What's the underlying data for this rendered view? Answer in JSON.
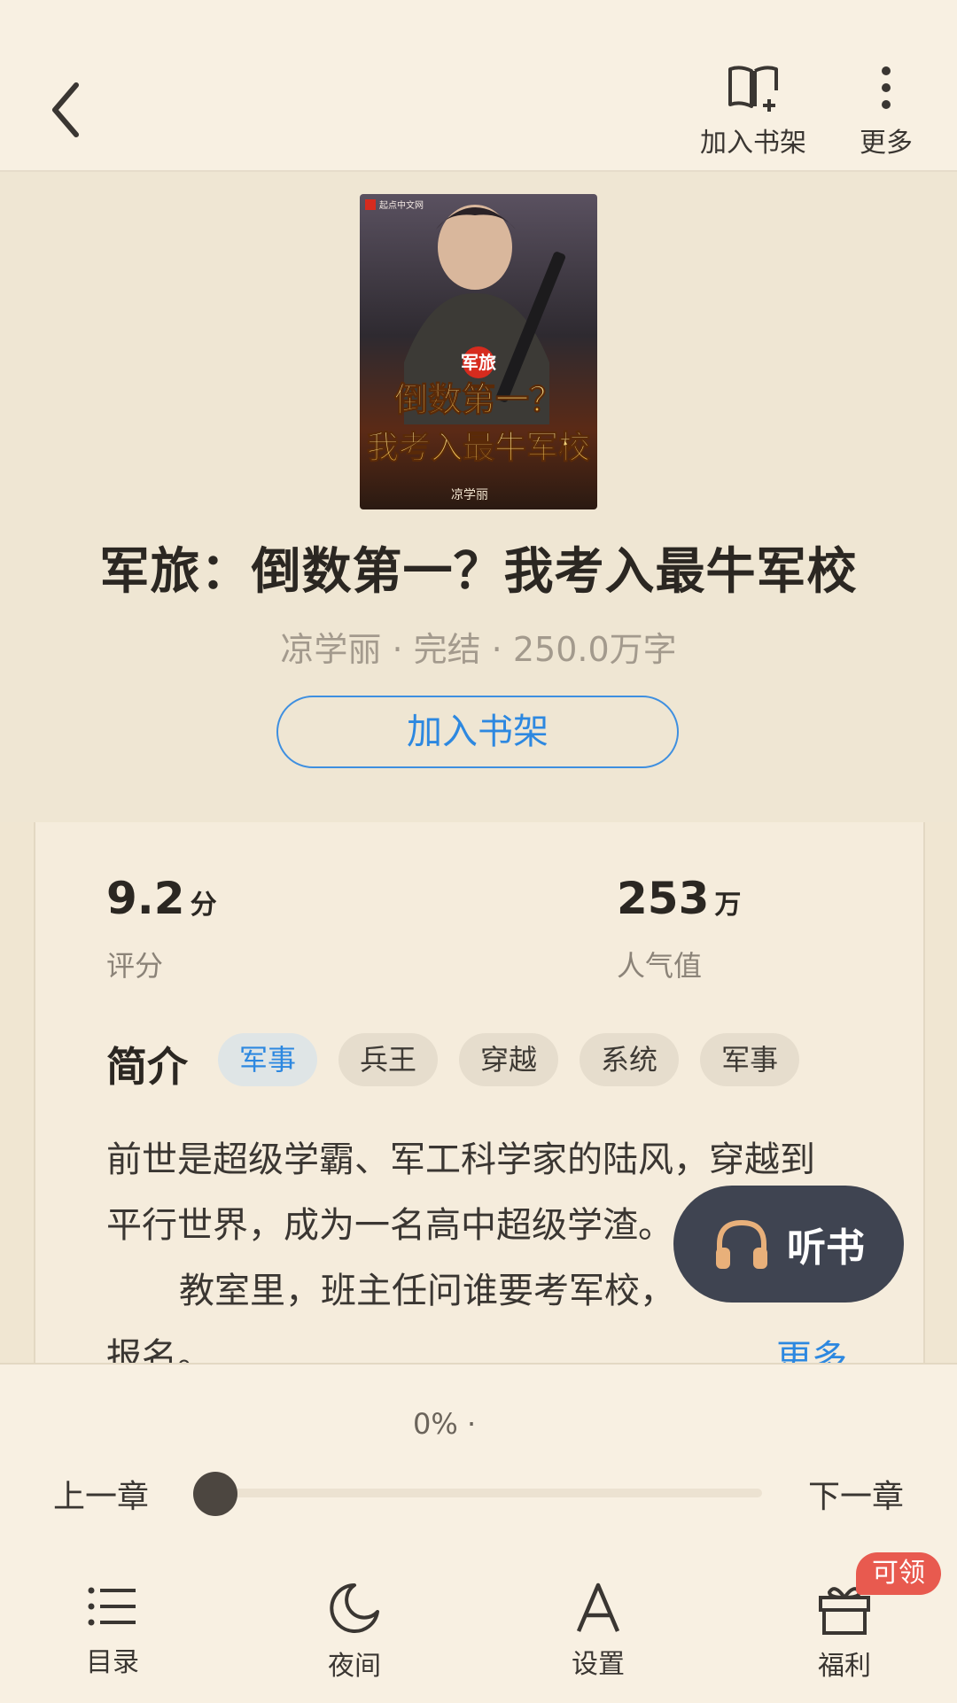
{
  "topbar": {
    "add_shelf_label": "加入书架",
    "more_label": "更多"
  },
  "book": {
    "cover_badge": "军旅",
    "cover_title_line1": "倒数第一？",
    "cover_title_line2": "我考入最牛军校",
    "cover_author": "凉学丽",
    "cover_publisher": "起点中文网",
    "title": "军旅：倒数第一？我考入最牛军校",
    "meta": "凉学丽 · 完结 · 250.0万字",
    "add_shelf_button": "加入书架"
  },
  "stats": {
    "score_value": "9.2",
    "score_unit": "分",
    "score_caption": "评分",
    "popularity_value": "253",
    "popularity_unit": "万",
    "popularity_caption": "人气值"
  },
  "intro": {
    "label": "简介",
    "tags": [
      "军事",
      "兵王",
      "穿越",
      "系统",
      "军事"
    ],
    "line1": "前世是超级学霸、军工科学家的陆风，穿越到",
    "line2": "平行世界，成为一名高中超级学渣。",
    "line3": "教室里，班主任问谁要考军校，",
    "line4": "报名。...",
    "more_label": "更多"
  },
  "listen": {
    "label": "听书"
  },
  "reader": {
    "progress_text": "0% ·",
    "progress": 0,
    "prev_chapter": "上一章",
    "next_chapter": "下一章"
  },
  "bottom_nav": {
    "toc": "目录",
    "night": "夜间",
    "settings": "设置",
    "welfare": "福利",
    "welfare_badge": "可领"
  },
  "colors": {
    "accent": "#2d88e0",
    "background": "#f5ecdc",
    "listen_bg": "#3f4451",
    "badge": "#e85a4f"
  }
}
